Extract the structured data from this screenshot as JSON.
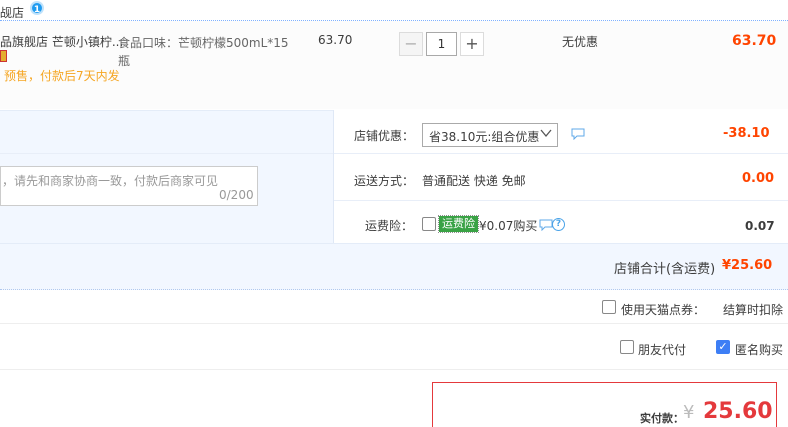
{
  "store": {
    "name": "觇店",
    "badge": "1"
  },
  "item": {
    "title": "品旗舰店 芒顿小镇柠...",
    "presale": "预售，付款后7天内发",
    "sku_line1": "食品口味：芒顿柠檬500mL*15",
    "sku_line2": "瓶",
    "unit_price": "63.70",
    "quantity": "1",
    "minus_label": "−",
    "plus_label": "+",
    "discount": "无优惠",
    "subtotal": "63.70"
  },
  "memo": {
    "placeholder": "，请先和商家协商一致，付款后商家可见",
    "count": "0/200"
  },
  "store_discount": {
    "label": "店铺优惠：",
    "selected": "省38.10元:组合优惠",
    "value": "-38.10"
  },
  "shipping": {
    "label": "运送方式：",
    "method": "普通配送 快递 免邮",
    "value": "0.00"
  },
  "insurance": {
    "label": "运费险：",
    "tag": "运费险",
    "price": "¥0.07购买",
    "help": "?",
    "value": "0.07"
  },
  "store_total": {
    "label": "店铺合计(含运费)",
    "value": "¥25.60"
  },
  "tmall_points": {
    "label": "使用天猫点券：",
    "deduct": "结算时扣除"
  },
  "options": {
    "friend_pay": "朋友代付",
    "anonymous": "匿名购买",
    "anonymous_mark": "✓"
  },
  "payment": {
    "label": "实付款：",
    "currency": "¥",
    "amount": "25.60"
  },
  "colors": {
    "accent": "#ff4400",
    "panel_bg": "#f2f7ff",
    "insurance_tag": "#39a245",
    "checkbox_checked": "#3d7ef5"
  }
}
